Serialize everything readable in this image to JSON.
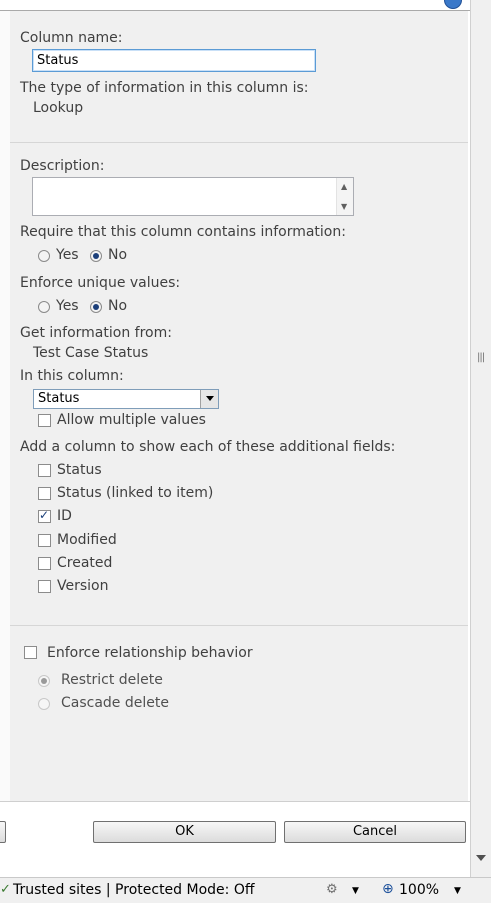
{
  "form": {
    "column_name_label": "Column name:",
    "column_name_value": "Status",
    "type_label": "The type of information in this column is:",
    "type_value": "Lookup",
    "description_label": "Description:",
    "description_value": "",
    "require_label": "Require that this column contains information:",
    "require_options": [
      "Yes",
      "No"
    ],
    "require_selected": "No",
    "unique_label": "Enforce unique values:",
    "unique_options": [
      "Yes",
      "No"
    ],
    "unique_selected": "No",
    "get_info_label": "Get information from:",
    "get_info_value": "Test Case Status",
    "in_column_label": "In this column:",
    "in_column_value": "Status",
    "allow_multiple_label": "Allow multiple values",
    "allow_multiple_checked": false,
    "additional_fields_label": "Add a column to show each of these additional fields:",
    "additional_fields": [
      {
        "label": "Status",
        "checked": false
      },
      {
        "label": "Status (linked to item)",
        "checked": false
      },
      {
        "label": "ID",
        "checked": true
      },
      {
        "label": "Modified",
        "checked": false
      },
      {
        "label": "Created",
        "checked": false
      },
      {
        "label": "Version",
        "checked": false
      }
    ],
    "enforce_relationship_label": "Enforce relationship behavior",
    "enforce_relationship_checked": false,
    "restrict_delete_label": "Restrict delete",
    "cascade_delete_label": "Cascade delete",
    "delete_selected": "Restrict delete"
  },
  "buttons": {
    "ok_label": "OK",
    "cancel_label": "Cancel"
  },
  "statusbar": {
    "zone_text": "Trusted sites | Protected Mode: Off",
    "zoom": "100%"
  },
  "colors": {
    "panel_bg": "#f0f0f0",
    "focus_border": "#5b9bd5",
    "radio_dot": "#1c3f7a"
  }
}
